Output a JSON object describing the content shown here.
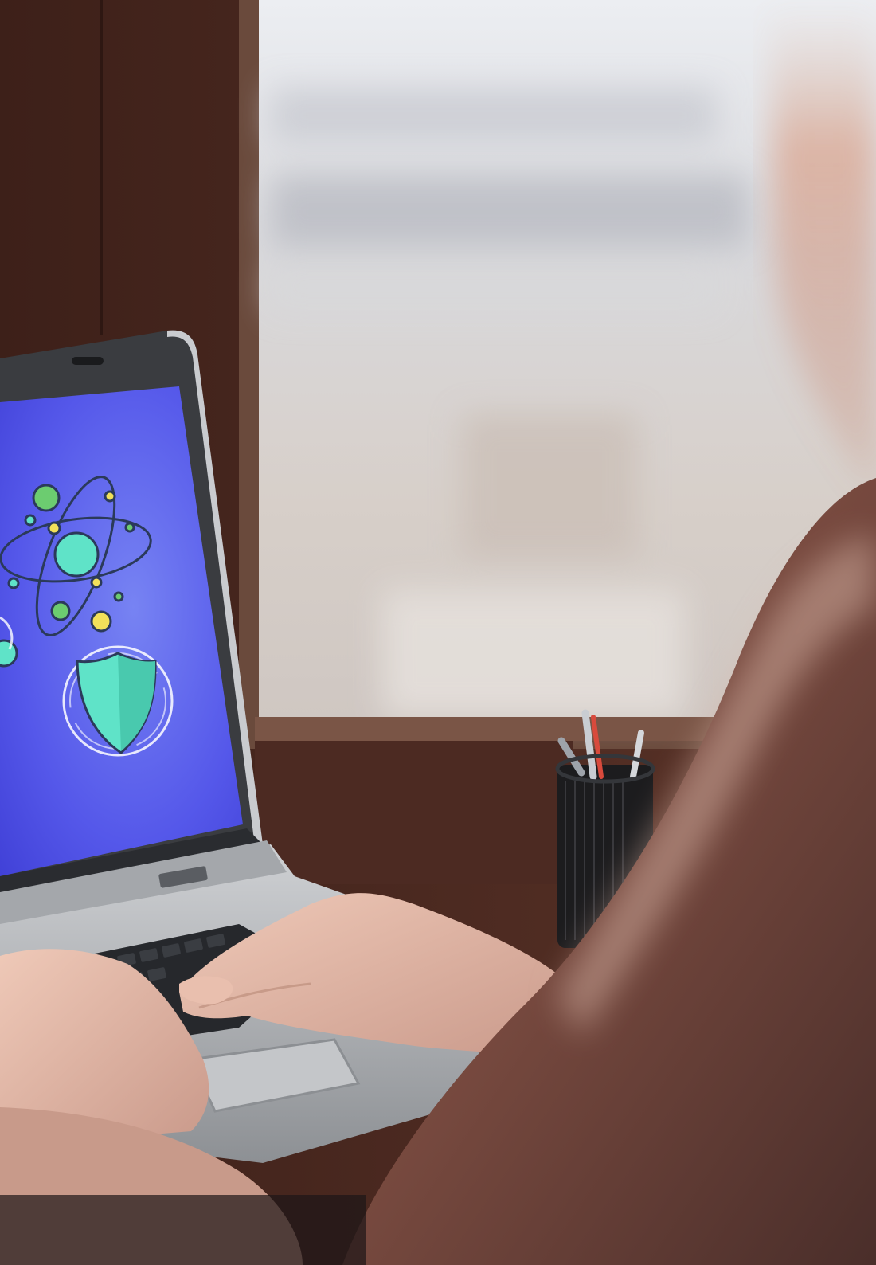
{
  "scene": {
    "description_alt": "",
    "colors": {
      "wall": "#4a2a22",
      "window_light": "#e6e4e2",
      "screen_blue": "#4f52e8",
      "screen_glow": "#6a78f0",
      "icon_teal": "#5fe3c8",
      "icon_green": "#6ccc70",
      "icon_yellow": "#f2e05a",
      "icon_outline": "#2b3a5a",
      "laptop_silver": "#b7b9bd",
      "laptop_dark": "#2a2c30",
      "skin": "#e2b7a5",
      "shoulder": "#5c3b35"
    },
    "screen": {
      "icons": [
        "atom-icon",
        "shield-icon",
        "planet-icon"
      ]
    }
  }
}
